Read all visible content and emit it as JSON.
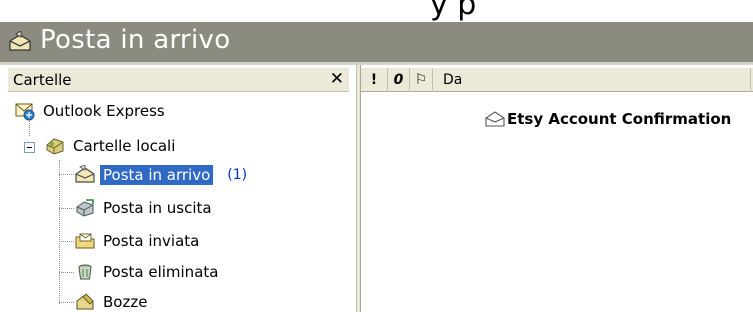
{
  "window": {
    "title": "Posta in arrivo",
    "top_text": "y p"
  },
  "folder_pane": {
    "header": "Cartelle",
    "close_glyph": "✕",
    "tree": {
      "root": "Outlook Express",
      "local": "Cartelle locali",
      "folders": [
        {
          "label": "Posta in arrivo",
          "count": "(1)",
          "selected": true
        },
        {
          "label": "Posta in uscita"
        },
        {
          "label": "Posta inviata"
        },
        {
          "label": "Posta eliminata"
        },
        {
          "label": "Bozze"
        }
      ]
    }
  },
  "message_list": {
    "columns": {
      "priority": "!",
      "attachment": "0",
      "flag": "⚐",
      "from": "Da"
    },
    "messages": [
      {
        "subject": "Etsy Account Confirmation",
        "icon": "envelope-icon"
      }
    ]
  },
  "colors": {
    "titlebar": "#8b8b80",
    "header": "#ece9d8",
    "selection": "#316ac5",
    "count": "#0033cc"
  }
}
